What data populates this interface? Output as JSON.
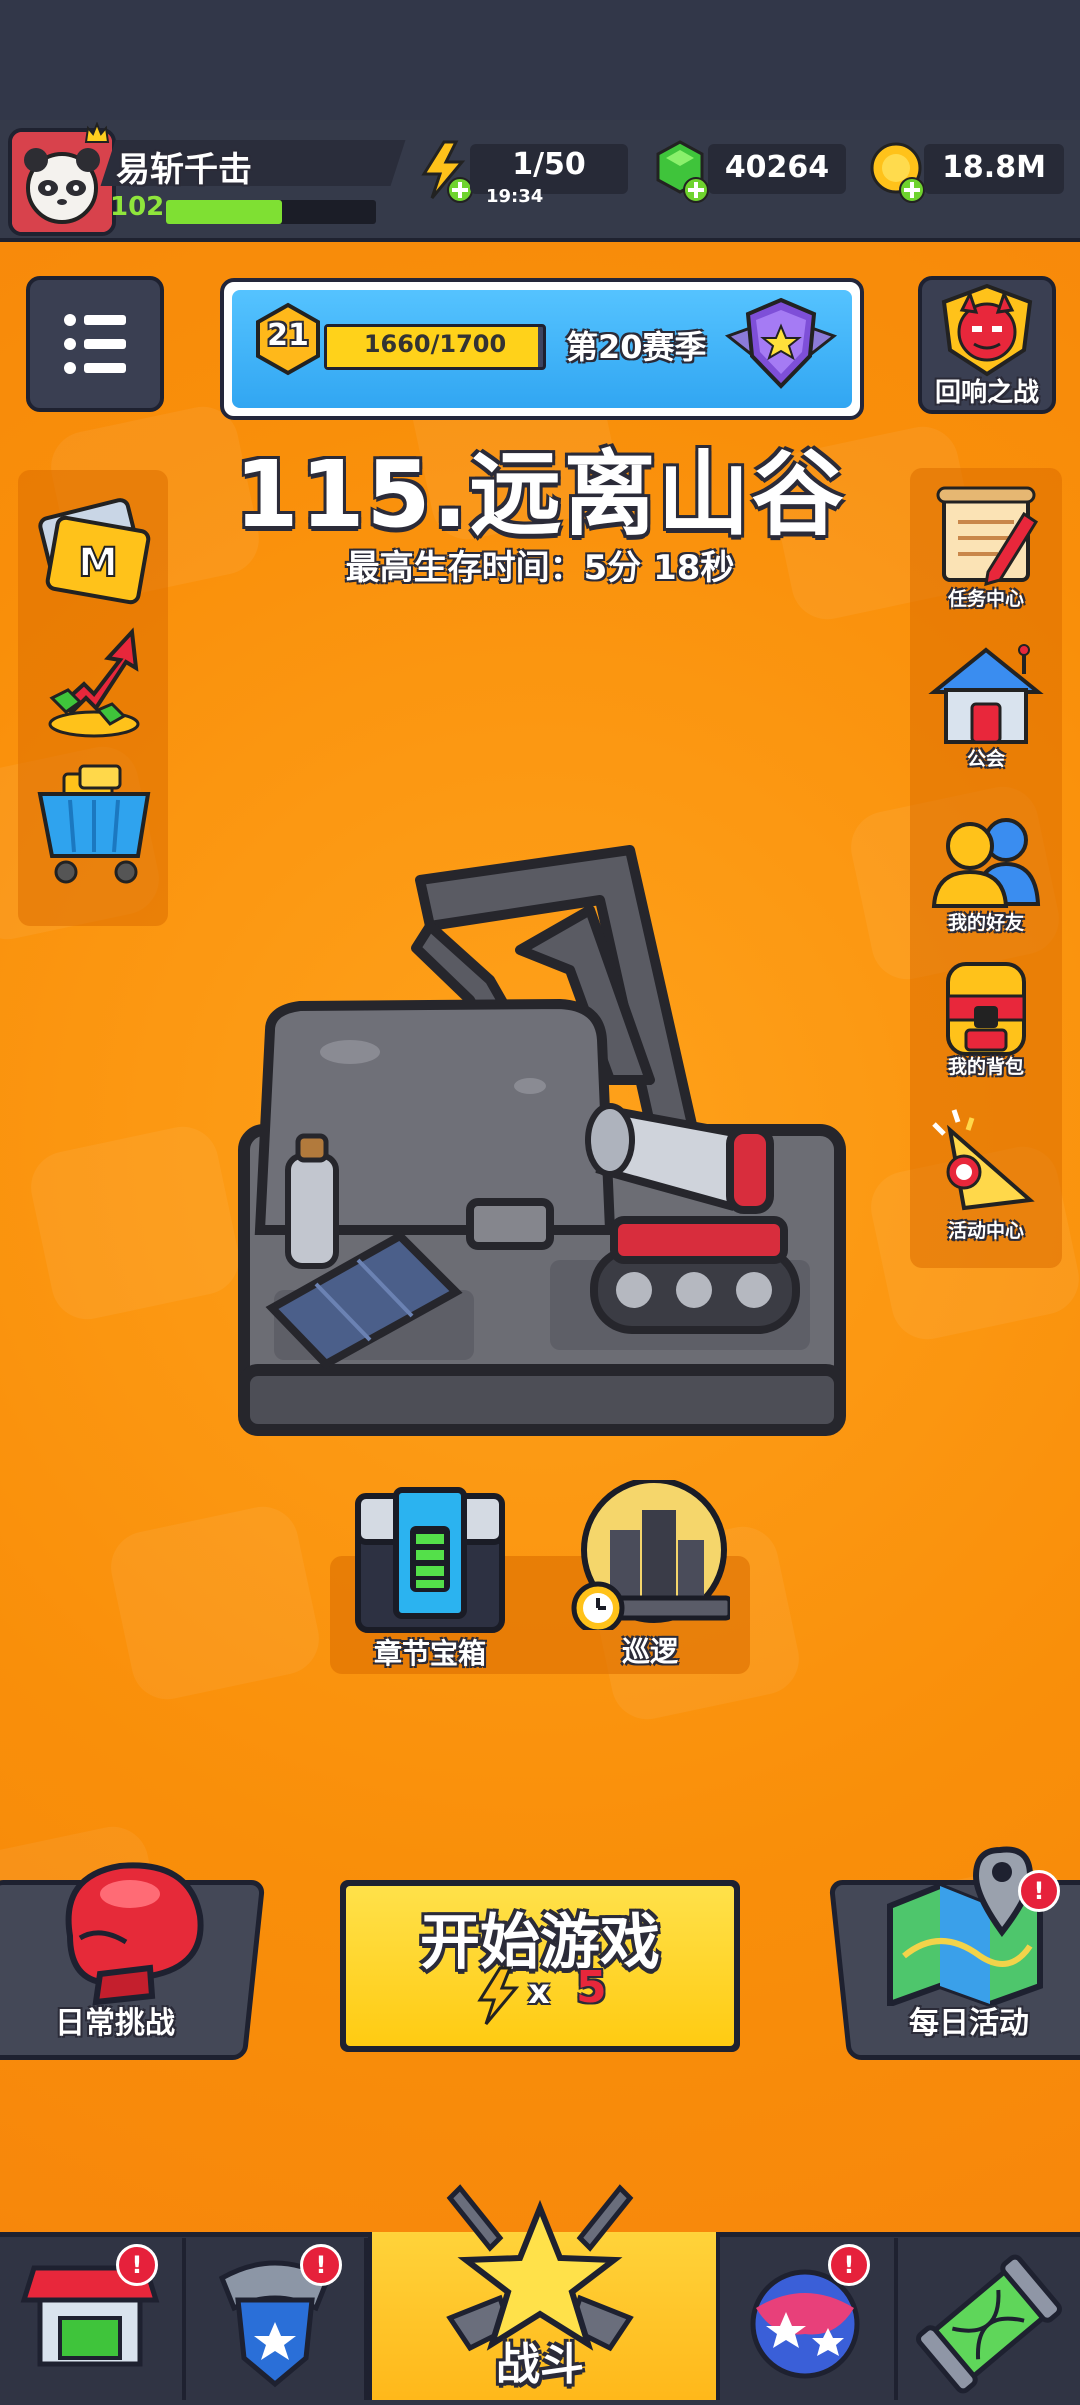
{
  "player": {
    "name": "易斩千击",
    "level": "102",
    "xp_fraction": 0.55
  },
  "resources": {
    "energy": "1/50",
    "energy_timer": "19:34",
    "gems": "40264",
    "coins": "18.8M"
  },
  "season": {
    "level": "21",
    "progress_text": "1660/1700",
    "progress_fraction": 0.976,
    "label": "第20赛季"
  },
  "stage": {
    "title": "115.远离山谷",
    "best_survival": "最高生存时间：5分 18秒"
  },
  "right_menu": [
    {
      "label": "回响之战",
      "icon": "demon-shield-icon"
    },
    {
      "label": "任务中心",
      "icon": "scroll-quest-icon"
    },
    {
      "label": "公会",
      "icon": "guild-house-icon"
    },
    {
      "label": "我的好友",
      "icon": "friends-icon"
    },
    {
      "label": "我的背包",
      "icon": "backpack-icon"
    },
    {
      "label": "活动中心",
      "icon": "party-horn-icon"
    }
  ],
  "left_menu": [
    {
      "icon": "menu-list-icon"
    },
    {
      "icon": "m-card-icon"
    },
    {
      "icon": "growth-arrow-icon"
    },
    {
      "icon": "shop-cart-icon"
    }
  ],
  "chest": {
    "label": "章节宝箱"
  },
  "patrol": {
    "label": "巡逻"
  },
  "actions": {
    "daily_challenge": "日常挑战",
    "start_game": "开始游戏",
    "energy_cost_x": "x",
    "energy_cost": "5",
    "daily_event": "每日活动"
  },
  "bottom_nav": [
    {
      "label": "",
      "icon": "shop-icon",
      "alert": "!"
    },
    {
      "label": "",
      "icon": "badge-icon",
      "alert": "!"
    },
    {
      "label": "战斗",
      "icon": "battle-star-icon",
      "alert": ""
    },
    {
      "label": "",
      "icon": "orb-icon",
      "alert": "!"
    },
    {
      "label": "",
      "icon": "dna-capsule-icon",
      "alert": ""
    }
  ],
  "colors": {
    "background": "#f7930f",
    "topbar": "#353a4a",
    "start_button": "#ffd21a",
    "xp_bar": "#7fe033",
    "season_bar": "#ffd21a"
  }
}
